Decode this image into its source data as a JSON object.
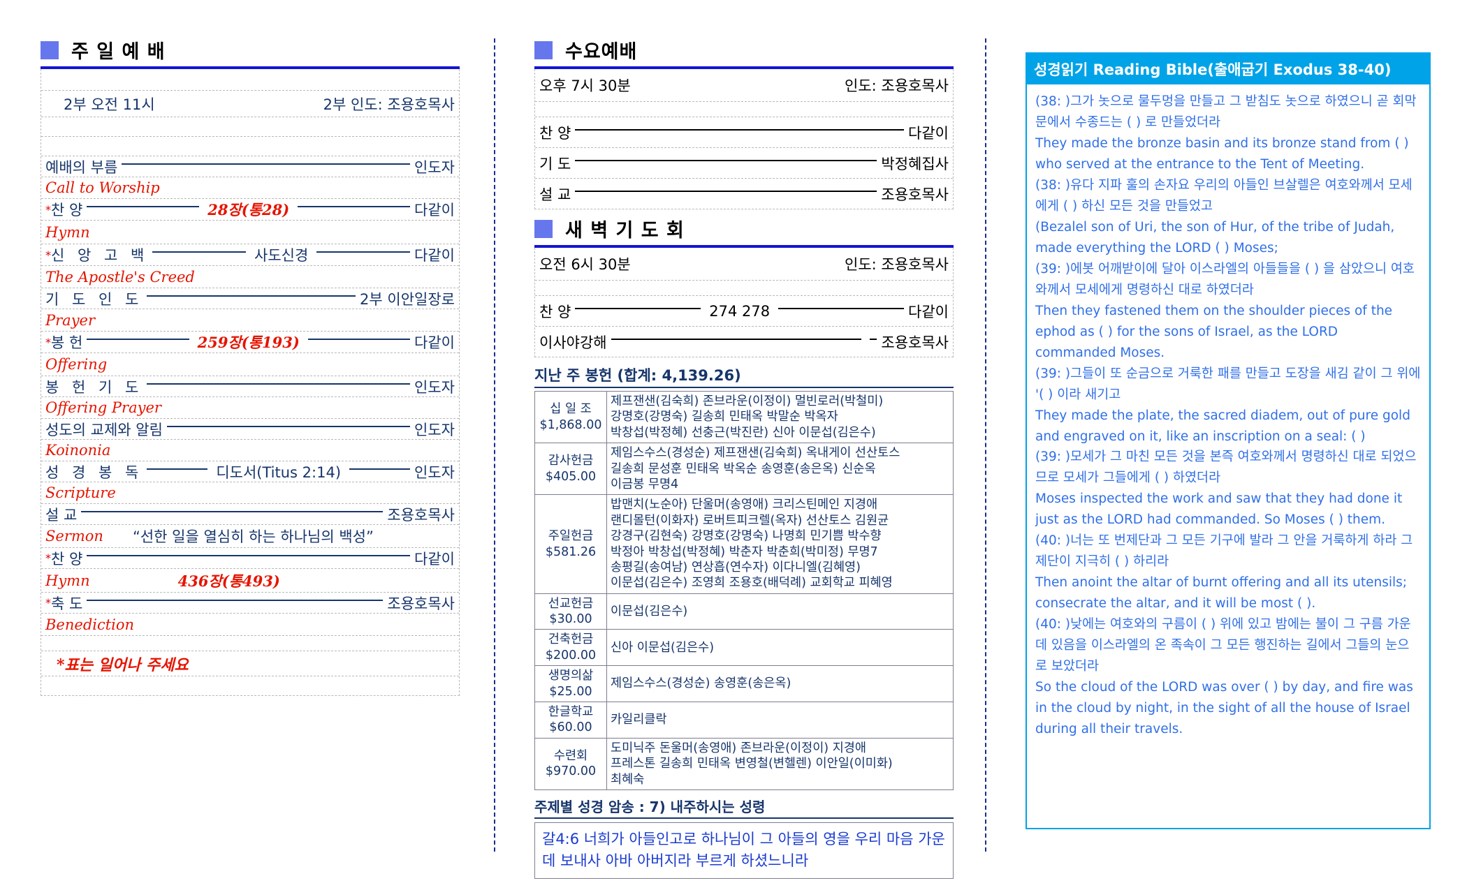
{
  "sunday": {
    "heading": "주 일 예 배",
    "time_line": {
      "left": "2부 오전 11시",
      "right": "2부 인도: 조용호목사"
    },
    "items": [
      {
        "ko": "예배의 부름",
        "spacing": "none",
        "star": false,
        "mid": "",
        "mid_red": false,
        "end": "인도자",
        "eng": "Call to Worship"
      },
      {
        "ko": "찬        양",
        "spacing": "none",
        "star": true,
        "mid": "28장(통28)",
        "mid_red": true,
        "end": "다같이",
        "eng": "Hymn"
      },
      {
        "ko": "신 앙 고 백",
        "spacing": "none",
        "star": true,
        "mid": "사도신경",
        "mid_red": false,
        "end": "다같이",
        "eng": "The Apostle's Creed"
      },
      {
        "ko": "기 도 인 도",
        "spacing": "none",
        "star": false,
        "mid": "",
        "mid_red": false,
        "end": "2부 이안일장로",
        "eng": "Prayer"
      },
      {
        "ko": "봉        헌",
        "spacing": "none",
        "star": true,
        "mid": "259장(통193)",
        "mid_red": true,
        "end": "다같이",
        "eng": "Offering"
      },
      {
        "ko": "봉 헌 기 도",
        "spacing": "none",
        "star": false,
        "mid": "",
        "mid_red": false,
        "end": "인도자",
        "eng": "Offering Prayer"
      },
      {
        "ko": "성도의 교제와 알림",
        "spacing": "none",
        "star": false,
        "mid": "",
        "mid_red": false,
        "end": "인도자",
        "eng": "Koinonia"
      },
      {
        "ko": "성 경 봉 독",
        "spacing": "none",
        "star": false,
        "mid": "디도서(Titus 2:14)",
        "mid_red": false,
        "end": "인도자",
        "eng": "Scripture"
      },
      {
        "ko": "설        교",
        "spacing": "none",
        "star": false,
        "mid": "",
        "mid_red": false,
        "end": "조용호목사",
        "eng": "Sermon"
      },
      {
        "ko": "찬        양",
        "spacing": "none",
        "star": true,
        "mid": "",
        "mid_red": false,
        "end": "다같이",
        "eng": "Hymn"
      },
      {
        "ko": "축        도",
        "spacing": "none",
        "star": true,
        "mid": "",
        "mid_red": false,
        "end": "조용호목사",
        "eng": "Benediction"
      }
    ],
    "sermon_title": "“선한 일을 열심히 하는 하나님의 백성”",
    "hymn_closing": "436장(통493)",
    "footnote": "*표는 일어나 주세요"
  },
  "wednesday": {
    "heading": "수요예배",
    "time": "오후 7시 30분",
    "leader": "인도: 조용호목사",
    "items": [
      {
        "ko": "찬        양",
        "end": "다같이"
      },
      {
        "ko": "기        도",
        "end": "박정혜집사"
      },
      {
        "ko": "설        교",
        "end": "조용호목사"
      }
    ]
  },
  "dawn": {
    "heading": "새 벽 기 도 회",
    "time": "오전 6시 30분",
    "leader": "인도: 조용호목사",
    "items": [
      {
        "ko": "찬        양",
        "mid": "274 278",
        "end": "다같이"
      },
      {
        "ko": "이사야강해",
        "mid": "",
        "end": "조용호목사"
      }
    ]
  },
  "offering": {
    "heading": "지난 주 봉헌  (합계: 4,139.26)",
    "rows": [
      {
        "category": "십 일 조",
        "amount": "$1,868.00",
        "names": "제프잰샌(김숙희) 존브라운(이정이) 멀빈로러(박철미)\n강명호(강명숙) 길송희 민태옥 박말순 박옥자\n박창섭(박정혜) 선충근(박진란) 신아 이문섭(김은수)"
      },
      {
        "category": "감사헌금",
        "amount": "$405.00",
        "names": "제임스수스(경성순) 제프잰샌(김숙희) 옥내게이 선산토스\n길송희 문성훈 민태옥 박옥순 송영훈(송은옥) 신순옥\n이금봉 무명4"
      },
      {
        "category": "주일헌금",
        "amount": "$581.26",
        "names": "밥맨치(노순아) 단울머(송영애) 크리스틴메인 지경애\n랜디몰턴(이화자) 로버트피크렐(옥자) 선산토스 김원균\n강경구(김현숙) 강명호(강명숙) 나명희 민기쁨 박수향\n박정아 박창섭(박정혜) 박춘자 박춘희(박미정) 무명7\n송평길(송여남) 연상흡(연수자) 이다니엘(김혜영)\n이문섭(김은수) 조영희 조용호(배덕례) 교회학교 피혜영"
      },
      {
        "category": "선교헌금",
        "amount": "$30.00",
        "names": "이문섭(김은수)"
      },
      {
        "category": "건축헌금",
        "amount": "$200.00",
        "names": "신아 이문섭(김은수)"
      },
      {
        "category": "생명의삶",
        "amount": "$25.00",
        "names": "제임스수스(경성순) 송영훈(송은옥)"
      },
      {
        "category": "한글학교",
        "amount": "$60.00",
        "names": "카일리클락"
      },
      {
        "category": "수련회",
        "amount": "$970.00",
        "names": "도미닉주 돈울머(송영애) 존브라운(이정이) 지경애\n프레스톤 길송희 민태옥 변영철(변헬렌) 이안일(이미화)\n최혜숙"
      }
    ]
  },
  "memory_verse": {
    "heading": "주제별 성경 암송 : 7) 내주하시는 성령",
    "text": "갈4:6 너희가 아들인고로 하나님이 그 아들의 영을 우리 마음 가운데 보내사 아바 아버지라 부르게 하셨느니라"
  },
  "bible_reading": {
    "heading": "성경읽기 Reading Bible(출애굽기 Exodus 38-40)",
    "lines": [
      "(38:    )그가 놋으로 물두멍을 만들고 그 받침도 놋으로 하였으니 곧 회막문에서 수종드는 (                ) 로 만들었더라",
      "They made the bronze basin and its bronze stand from (              ) who served at the entrance to the Tent of Meeting.",
      "(38:    )유다 지파 훌의 손자요 우리의 아들인 브살렐은 여호와께서 모세에게 (              ) 하신 모든 것을 만들었고",
      "(Bezalel son of Uri, the son of Hur, of the tribe of Judah, made everything the LORD (              ) Moses;",
      "(39:    )에봇 어깨받이에 달아 이스라엘의 아들들을 (              ) 을 삼았으니 여호와께서 모세에게 명령하신 대로 하였더라",
      "Then  they  fastened  them  on  the  shoulder  pieces  of  the  ephod  as  (              ) for the sons of Israel, as the LORD commanded Moses.",
      "(39:    )그들이 또 순금으로 거룩한 패를 만들고 도장을 새김 같이 그 위에 '(              ) 이라 새기고",
      "They made the plate, the sacred diadem, out of pure gold and engraved on it, like an inscription on a seal: (              )",
      "(39:    )모세가 그 마친 모든 것을 본즉 여호와께서 명령하신 대로 되었으므로 모세가 그들에게 (                ) 하였더라",
      "Moses inspected the work and saw that they had done it just as the LORD had commanded. So Moses (              ) them.",
      "(40:    )너는 또 번제단과 그 모든 기구에 발라 그 안을 거룩하게 하라 그 제단이 지극히 (              ) 하리라",
      "Then anoint the altar of burnt offering and all its utensils; consecrate the altar, and it will be most (              ).",
      "(40:    )낮에는 여호와의 구름이 (                ) 위에 있고 밤에는 불이 그 구름 가운데 있음을 이스라엘의 온 족속이 그 모든 행진하는 길에서 그들의 눈으로 보았더라",
      "So the cloud of the LORD was over (              ) by day, and fire was in the cloud by night, in the sight of all the house of Israel during all their travels."
    ]
  },
  "colors": {
    "accent_blue": "#1414d2",
    "square_blue": "#6677ee",
    "bible_cyan": "#00a3e8",
    "dark_navy": "#16356b",
    "red": "#e51400"
  }
}
